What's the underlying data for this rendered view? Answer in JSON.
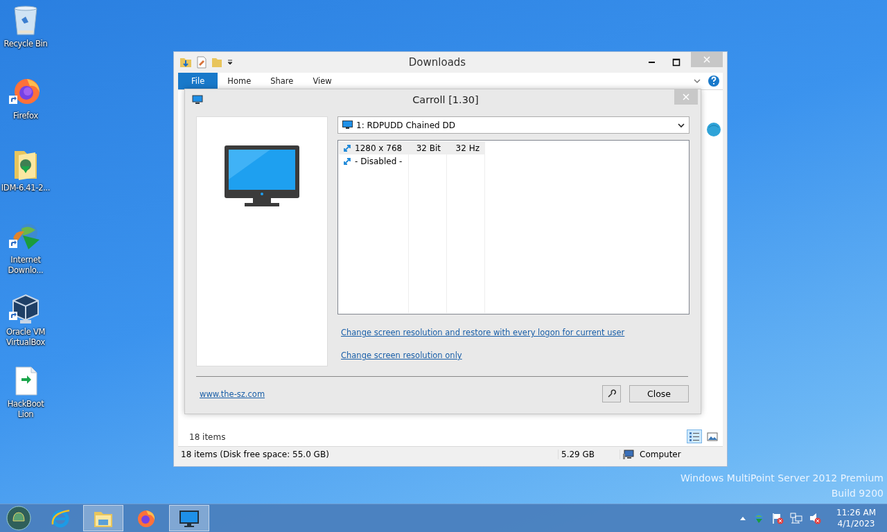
{
  "desktop": {
    "icons": [
      {
        "label": "Recycle Bin",
        "kind": "recycle",
        "shortcut": false
      },
      {
        "label": "Firefox",
        "kind": "firefox",
        "shortcut": true
      },
      {
        "label": "IDM-6.41-2...",
        "kind": "folder",
        "shortcut": false
      },
      {
        "label": "Internet Downlo...",
        "kind": "idm",
        "shortcut": true
      },
      {
        "label": "Oracle VM VirtualBox",
        "kind": "virtualbox",
        "shortcut": true
      },
      {
        "label": "HackBoot Lion",
        "kind": "file",
        "shortcut": false
      }
    ],
    "watermark": [
      "Windows MultiPoint Server 2012 Premium",
      "Build 9200"
    ]
  },
  "explorer": {
    "title": "Downloads",
    "ribbon_tabs": [
      {
        "label": "File",
        "selected": true
      },
      {
        "label": "Home",
        "selected": false
      },
      {
        "label": "Share",
        "selected": false
      },
      {
        "label": "View",
        "selected": false
      }
    ],
    "item_count": "18 items",
    "view_buttons": [
      {
        "kind": "details",
        "selected": true
      },
      {
        "kind": "thumbnails",
        "selected": false
      }
    ],
    "status_bar": [
      "18 items (Disk free space: 55.0 GB)",
      "5.29 GB",
      "Computer"
    ]
  },
  "dialog": {
    "title": "Carroll [1.30]",
    "display": "1: RDPUDD Chained DD",
    "modes": [
      {
        "cells": [
          "1280 x 768",
          "32 Bit",
          "32 Hz"
        ],
        "selected": true
      },
      {
        "cells": [
          "- Disabled -"
        ],
        "selected": false
      }
    ],
    "links": [
      "Change screen resolution and restore with every logon for current user",
      "Change screen resolution only"
    ],
    "website": "www.the-sz.com",
    "close_button": "Close"
  },
  "taskbar": {
    "apps": [
      {
        "kind": "ie",
        "active": false
      },
      {
        "kind": "explorer",
        "active": true
      },
      {
        "kind": "firefox",
        "active": false
      },
      {
        "kind": "monitor",
        "active": true
      }
    ],
    "time": "11:26 AM",
    "date": "4/1/2023"
  }
}
